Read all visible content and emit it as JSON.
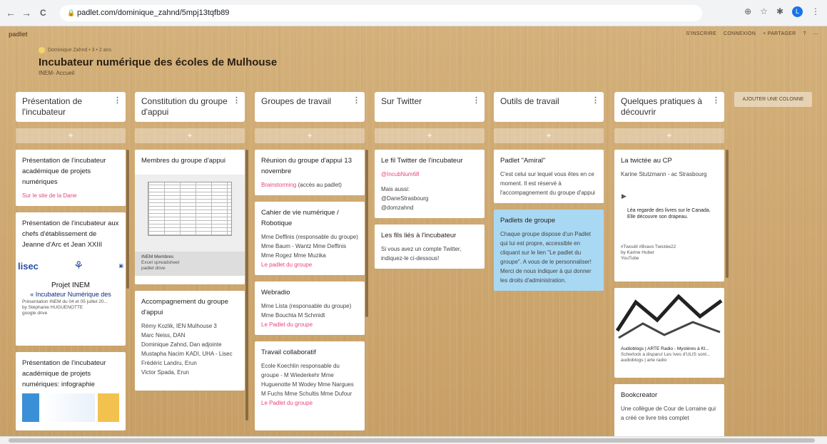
{
  "browser": {
    "back": "←",
    "forward": "→",
    "reload": "C",
    "url": "padlet.com/dominique_zahnd/5mpj13tqfb89"
  },
  "padlet": {
    "brand": "padlet",
    "actions": [
      "S'INSCRIRE",
      "CONNEXION",
      "+ PARTAGER",
      "?",
      "⋯"
    ],
    "author_line": "Dominique Zahnd • 3 • 2 ans",
    "title": "Incubateur numérique des écoles de Mulhouse",
    "subtitle": "INEM- Accueil",
    "add_column": "AJOUTER UNE COLONNE"
  },
  "columns": [
    {
      "title": "Présentation de l'incubateur",
      "cards": [
        {
          "title": "Présentation de l'incubateur académique de projets numériques",
          "link": "Sur le site de la Dane"
        },
        {
          "title": "Présentation de l'incubateur aux chefs d'établissement de Jeanne d'Arc et Jean XXIII",
          "embed_title": "Projet INEM",
          "embed_text": "« Incubateur Numérique des Ecoles de Mulhouse »",
          "caption": "Présentation INEM du 04 et 05 juillet 20...",
          "by": "by Stéphanie HUGUENOTTE",
          "source": "google drive"
        },
        {
          "title": "Présentation de l'incubateur académique de projets numériques: infographie"
        }
      ]
    },
    {
      "title": "Constitution du groupe d'appui",
      "cards": [
        {
          "title": "Membres du groupe d'appui",
          "file_name": "INEM Membres",
          "file_type": "Excel spreadsheet",
          "source": "padlet drive"
        },
        {
          "title": "Accompagnement du groupe d'appui",
          "body": [
            "Rémy Kozlik, IEN Mulhouse 3",
            "Marc Neiss, DAN",
            "Dominique Zahnd, Dan adjointe",
            "Mustapha Nacim KADI, UHA - Lisec",
            "Frédéric Landru, Erun",
            "Victor Spada, Erun"
          ]
        }
      ]
    },
    {
      "title": "Groupes de travail",
      "cards": [
        {
          "title": "Réunion du groupe d'appui 13 novembre",
          "link": "Brainstorming",
          "text": " (accès au padlet)"
        },
        {
          "title": "Cahier de vie numérique / Robotique",
          "body": "Mme Deffinis (responsable du groupe) Mme Baum - Wantz Mme Deffinis Mme Rogez Mme Muzika",
          "link": "Le padlet du groupe"
        },
        {
          "title": "Webradio",
          "body": "Mme Lista (responsable du groupe) Mme Bouchta M Schmidt",
          "link": "Le Padlet du groupe"
        },
        {
          "title": "Travail collaboratif",
          "body": "Ecole Koechlin responsable du groupe - M Wiederkehr Mme Huguenotte M Wodey Mme Nargues M Fuchs Mme Schultis Mme Dufour",
          "link": "Le Padlet du groupe"
        }
      ]
    },
    {
      "title": "Sur Twitter",
      "cards": [
        {
          "title": "Le fil Twitter de l'incubateur",
          "link": "@IncubNum68",
          "body": [
            "Mais aussi:",
            "@DaneStrasbourg",
            "@domzahnd"
          ]
        },
        {
          "title": "Les fils liés à l'incubateur",
          "body": "Si vous avez un compte Twitter, indiquez-le ci-dessous!"
        }
      ]
    },
    {
      "title": "Outils de travail",
      "cards": [
        {
          "title": "Padlet \"Amiral\"",
          "body": "C'est celui sur lequel vous êtes en ce moment. Il est réservé à l'accompagnement du groupe d'appui"
        },
        {
          "title": "Padlets de groupe",
          "body": "Chaque groupe dispose d'un Padlet qui lui est propre, accessible en cliquant sur le lien \"Le padlet du groupe\". A vous de le personnaliser! Merci de nous indiquer à qui donner les droits d'administration."
        }
      ]
    },
    {
      "title": "Quelques pratiques à découvrir",
      "cards": [
        {
          "title": "La twictée au CP",
          "body": "Karine Stutzmann - ac Strasbourg",
          "video_text": "Léa regarde des livres sur le Canada. Elle découvre son drapeau.",
          "caption": "#Twoutil #Bravo Twictée22",
          "by": "by Karine Huber",
          "source": "YouTube"
        },
        {
          "caption": "Audioblogs | ARTE Radio - Mystères à Kl...",
          "by": "Scherlock a disparu! Les Ives d'ULIS sont...",
          "source": "audioblogs | arte radio"
        },
        {
          "title": "Bookcreator",
          "body": "Une collègue de Cour de Lorraine qui a créé ce livre très complet"
        }
      ]
    }
  ]
}
